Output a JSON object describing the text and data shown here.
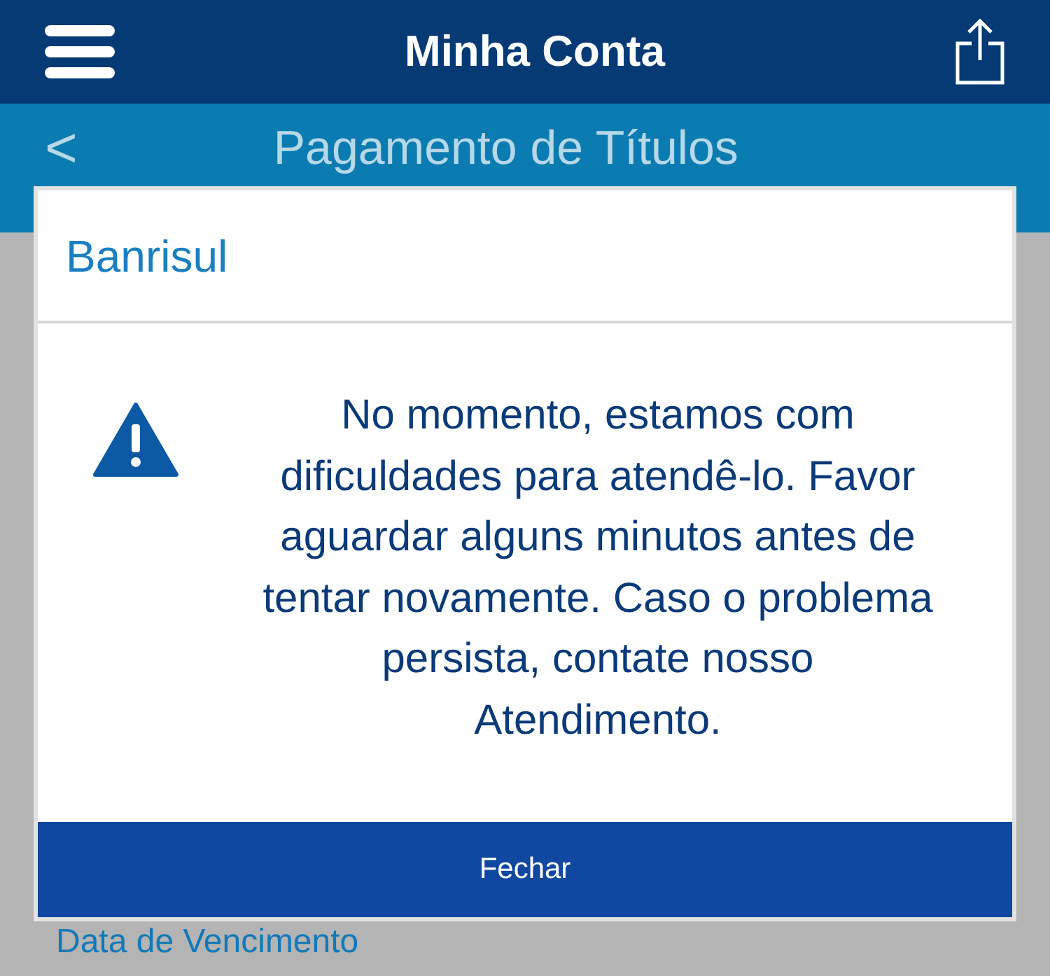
{
  "top_bar": {
    "title": "Minha Conta"
  },
  "sub_bar": {
    "back": "<",
    "title": "Pagamento de Títulos"
  },
  "page": {
    "field_label": "Data de Vencimento"
  },
  "dialog": {
    "title": "Banrisul",
    "message": "No momento, estamos com dificuldades para atendê-lo. Favor aguardar alguns minutos antes de tentar novamente. Caso o problema persista, contate nosso Atendimento.",
    "button": "Fechar"
  }
}
